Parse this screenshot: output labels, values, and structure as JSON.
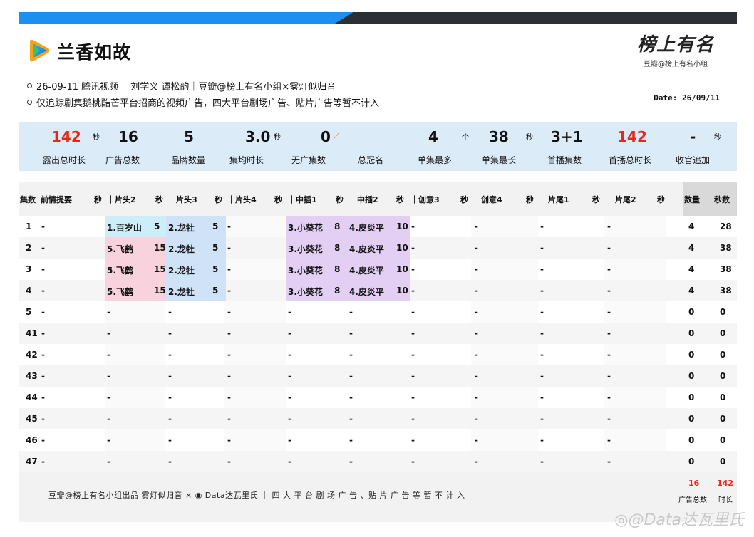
{
  "header": {
    "title": "兰香如故",
    "brand_sub": "豆瓣@榜上有名小组",
    "info_line1": "26-09-11 腾讯视频｜ 刘学义 谭松韵｜豆瓣@榜上有名小组×雾灯似归音",
    "info_line2": "仅追踪剧集鹅桃酷芒平台招商的视频广告，四大平台剧场广告、贴片广告等暂不计入",
    "date": "Date: 26/09/11"
  },
  "stats": [
    {
      "value": "142",
      "unit": "秒",
      "label": "露出总时长"
    },
    {
      "value": "16",
      "unit": "",
      "label": "广告总数"
    },
    {
      "value": "5",
      "unit": "",
      "label": "品牌数量"
    },
    {
      "value": "3.0",
      "unit": "秒",
      "label": "集均时长"
    },
    {
      "value": "0",
      "unit": "",
      "label": "无广集数"
    },
    {
      "value": "",
      "unit": "",
      "label": "总冠名"
    },
    {
      "value": "4",
      "unit": "个",
      "label": "单集最多"
    },
    {
      "value": "38",
      "unit": "秒",
      "label": "单集最长"
    },
    {
      "value": "3+1",
      "unit": "",
      "label": "首播集数"
    },
    {
      "value": "142",
      "unit": "",
      "label": "首播总时长"
    },
    {
      "value": "-",
      "unit": "秒",
      "label": "收官追加"
    }
  ],
  "table": {
    "headers": {
      "episode": "集数",
      "summary": "前情提要",
      "sec": "秒",
      "h2": "｜片头2",
      "h3": "｜片头3",
      "h4": "｜片头4",
      "m1": "｜中插1",
      "m2": "｜中插2",
      "c3": "｜创意3",
      "c4": "｜创意4",
      "e1": "｜片尾1",
      "e2": "｜片尾2",
      "count": "数量",
      "seconds": "秒数"
    },
    "rows": [
      {
        "ep": "1",
        "sum": "-",
        "h2": "1.百岁山",
        "h2s": "5",
        "h3": "2.龙牡",
        "h3s": "5",
        "h4": "-",
        "m1": "3.小葵花",
        "m1s": "8",
        "m2": "4.皮炎平",
        "m2s": "10",
        "c3": "-",
        "c4": "-",
        "e1": "-",
        "e2": "-",
        "n": "4",
        "s": "28"
      },
      {
        "ep": "2",
        "sum": "-",
        "h2": "5.飞鹤",
        "h2s": "15",
        "h3": "2.龙牡",
        "h3s": "5",
        "h4": "-",
        "m1": "3.小葵花",
        "m1s": "8",
        "m2": "4.皮炎平",
        "m2s": "10",
        "c3": "-",
        "c4": "-",
        "e1": "-",
        "e2": "-",
        "n": "4",
        "s": "38"
      },
      {
        "ep": "3",
        "sum": "-",
        "h2": "5.飞鹤",
        "h2s": "15",
        "h3": "2.龙牡",
        "h3s": "5",
        "h4": "-",
        "m1": "3.小葵花",
        "m1s": "8",
        "m2": "4.皮炎平",
        "m2s": "10",
        "c3": "-",
        "c4": "-",
        "e1": "-",
        "e2": "-",
        "n": "4",
        "s": "38"
      },
      {
        "ep": "4",
        "sum": "-",
        "h2": "5.飞鹤",
        "h2s": "15",
        "h3": "2.龙牡",
        "h3s": "5",
        "h4": "-",
        "m1": "3.小葵花",
        "m1s": "8",
        "m2": "4.皮炎平",
        "m2s": "10",
        "c3": "-",
        "c4": "-",
        "e1": "-",
        "e2": "-",
        "n": "4",
        "s": "38"
      },
      {
        "ep": "5",
        "sum": "-",
        "h2": "-",
        "h2s": "",
        "h3": "-",
        "h3s": "",
        "h4": "-",
        "m1": "-",
        "m1s": "",
        "m2": "-",
        "m2s": "",
        "c3": "-",
        "c4": "-",
        "e1": "-",
        "e2": "-",
        "n": "0",
        "s": "0"
      },
      {
        "ep": "41",
        "sum": "-",
        "h2": "-",
        "h2s": "",
        "h3": "-",
        "h3s": "",
        "h4": "-",
        "m1": "-",
        "m1s": "",
        "m2": "-",
        "m2s": "",
        "c3": "-",
        "c4": "-",
        "e1": "-",
        "e2": "-",
        "n": "0",
        "s": "0"
      },
      {
        "ep": "42",
        "sum": "-",
        "h2": "-",
        "h2s": "",
        "h3": "-",
        "h3s": "",
        "h4": "-",
        "m1": "-",
        "m1s": "",
        "m2": "-",
        "m2s": "",
        "c3": "-",
        "c4": "-",
        "e1": "-",
        "e2": "-",
        "n": "0",
        "s": "0"
      },
      {
        "ep": "43",
        "sum": "-",
        "h2": "-",
        "h2s": "",
        "h3": "-",
        "h3s": "",
        "h4": "-",
        "m1": "-",
        "m1s": "",
        "m2": "-",
        "m2s": "",
        "c3": "-",
        "c4": "-",
        "e1": "-",
        "e2": "-",
        "n": "0",
        "s": "0"
      },
      {
        "ep": "44",
        "sum": "-",
        "h2": "-",
        "h2s": "",
        "h3": "-",
        "h3s": "",
        "h4": "-",
        "m1": "-",
        "m1s": "",
        "m2": "-",
        "m2s": "",
        "c3": "-",
        "c4": "-",
        "e1": "-",
        "e2": "-",
        "n": "0",
        "s": "0"
      },
      {
        "ep": "45",
        "sum": "-",
        "h2": "-",
        "h2s": "",
        "h3": "-",
        "h3s": "",
        "h4": "-",
        "m1": "-",
        "m1s": "",
        "m2": "-",
        "m2s": "",
        "c3": "-",
        "c4": "-",
        "e1": "-",
        "e2": "-",
        "n": "0",
        "s": "0"
      },
      {
        "ep": "46",
        "sum": "-",
        "h2": "-",
        "h2s": "",
        "h3": "-",
        "h3s": "",
        "h4": "-",
        "m1": "-",
        "m1s": "",
        "m2": "-",
        "m2s": "",
        "c3": "-",
        "c4": "-",
        "e1": "-",
        "e2": "-",
        "n": "0",
        "s": "0"
      },
      {
        "ep": "47",
        "sum": "-",
        "h2": "-",
        "h2s": "",
        "h3": "-",
        "h3s": "",
        "h4": "-",
        "m1": "-",
        "m1s": "",
        "m2": "-",
        "m2s": "",
        "c3": "-",
        "c4": "-",
        "e1": "-",
        "e2": "-",
        "n": "0",
        "s": "0"
      }
    ]
  },
  "footer": {
    "text": "豆瓣@榜上有名小组出品  雾灯似归音 × ◉ Data达瓦里氏 ｜ 四 大 平 台 剧 场 广 告 、贴 片 广 告 等 暂 不 计 入",
    "total_count": "16",
    "total_count_label": "广告总数",
    "total_secs": "142",
    "total_secs_label": "时长"
  },
  "colors": {
    "accent_red": "#e8261a",
    "stats_bg": "#dcebf8",
    "top_blue": "#1d8ff0",
    "cell_cyan": "#cdeef8",
    "cell_pink": "#f8d2dc",
    "cell_blue": "#cfe2f7",
    "cell_purple": "#e3cff4"
  }
}
